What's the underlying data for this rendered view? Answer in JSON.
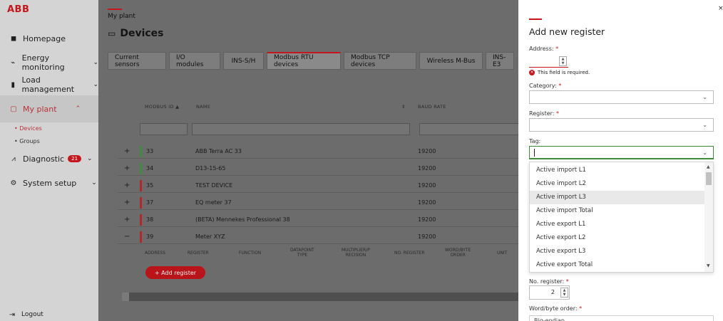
{
  "brand": {
    "logo_text": "ABB",
    "accent": "#c4161c"
  },
  "sidebar": {
    "items": [
      {
        "label": "Homepage",
        "icon": "home-icon"
      },
      {
        "label": "Energy monitoring",
        "icon": "energy-icon"
      },
      {
        "label": "Load management",
        "icon": "bar-chart-icon"
      },
      {
        "label": "My plant",
        "icon": "plant-icon"
      },
      {
        "label": "Diagnostic",
        "icon": "pulse-icon",
        "badge": "21"
      },
      {
        "label": "System setup",
        "icon": "gear-icon"
      }
    ],
    "subitems": [
      "• Devices",
      "• Groups"
    ],
    "logout": "Logout"
  },
  "main": {
    "breadcrumb": "My plant",
    "title": "Devices",
    "tabs": [
      "Current sensors",
      "I/O modules",
      "INS-S/H",
      "Modbus RTU devices",
      "Modbus TCP devices",
      "Wireless M-Bus",
      "INS-E3"
    ],
    "active_tab": "Modbus RTU devices",
    "columns": {
      "id": "MODBUS ID ▲",
      "name": "NAME",
      "baud": "BAUD RATE"
    },
    "rows": [
      {
        "expand": "+",
        "id": "33",
        "name": "ABB Terra AC 33",
        "baud": "19200",
        "status": "#3c8c3c"
      },
      {
        "expand": "+",
        "id": "34",
        "name": "D13-15-65",
        "baud": "19200",
        "status": "#3c8c3c"
      },
      {
        "expand": "+",
        "id": "35",
        "name": "TEST DEVICE",
        "baud": "19200",
        "status": "#b3262c"
      },
      {
        "expand": "+",
        "id": "37",
        "name": "EQ meter 37",
        "baud": "19200",
        "status": "#b3262c"
      },
      {
        "expand": "+",
        "id": "38",
        "name": "(BETA) Mennekes Professional 38",
        "baud": "19200",
        "status": "#b3262c"
      },
      {
        "expand": "−",
        "id": "39",
        "name": "Meter XYZ",
        "baud": "19200",
        "status": "#b3262c"
      }
    ],
    "register_columns": [
      "ADDRESS",
      "REGISTER",
      "FUNCTION",
      "DATAPOINT\nTYPE",
      "MULTIPLIER/P\nRECISION",
      "NO. REGISTER",
      "WORD/BYTE\nORDER",
      "UNIT"
    ],
    "add_register_label": "+ Add register"
  },
  "drawer": {
    "close": "×",
    "title": "Add new register",
    "address_label": "Address:",
    "required_mark": "*",
    "error_text": "This field is required.",
    "category_label": "Category:",
    "register_label": "Register:",
    "tag_label": "Tag:",
    "tag_options": [
      "Active import L1",
      "Active import L2",
      "Active import L3",
      "Active import Total",
      "Active export L1",
      "Active export L2",
      "Active export L3",
      "Active export Total"
    ],
    "highlighted_option": "Active import L3",
    "no_register_label": "No. register:",
    "no_register_value": "2",
    "word_byte_label": "Word/byte order:",
    "word_byte_value": "Big-endian"
  }
}
